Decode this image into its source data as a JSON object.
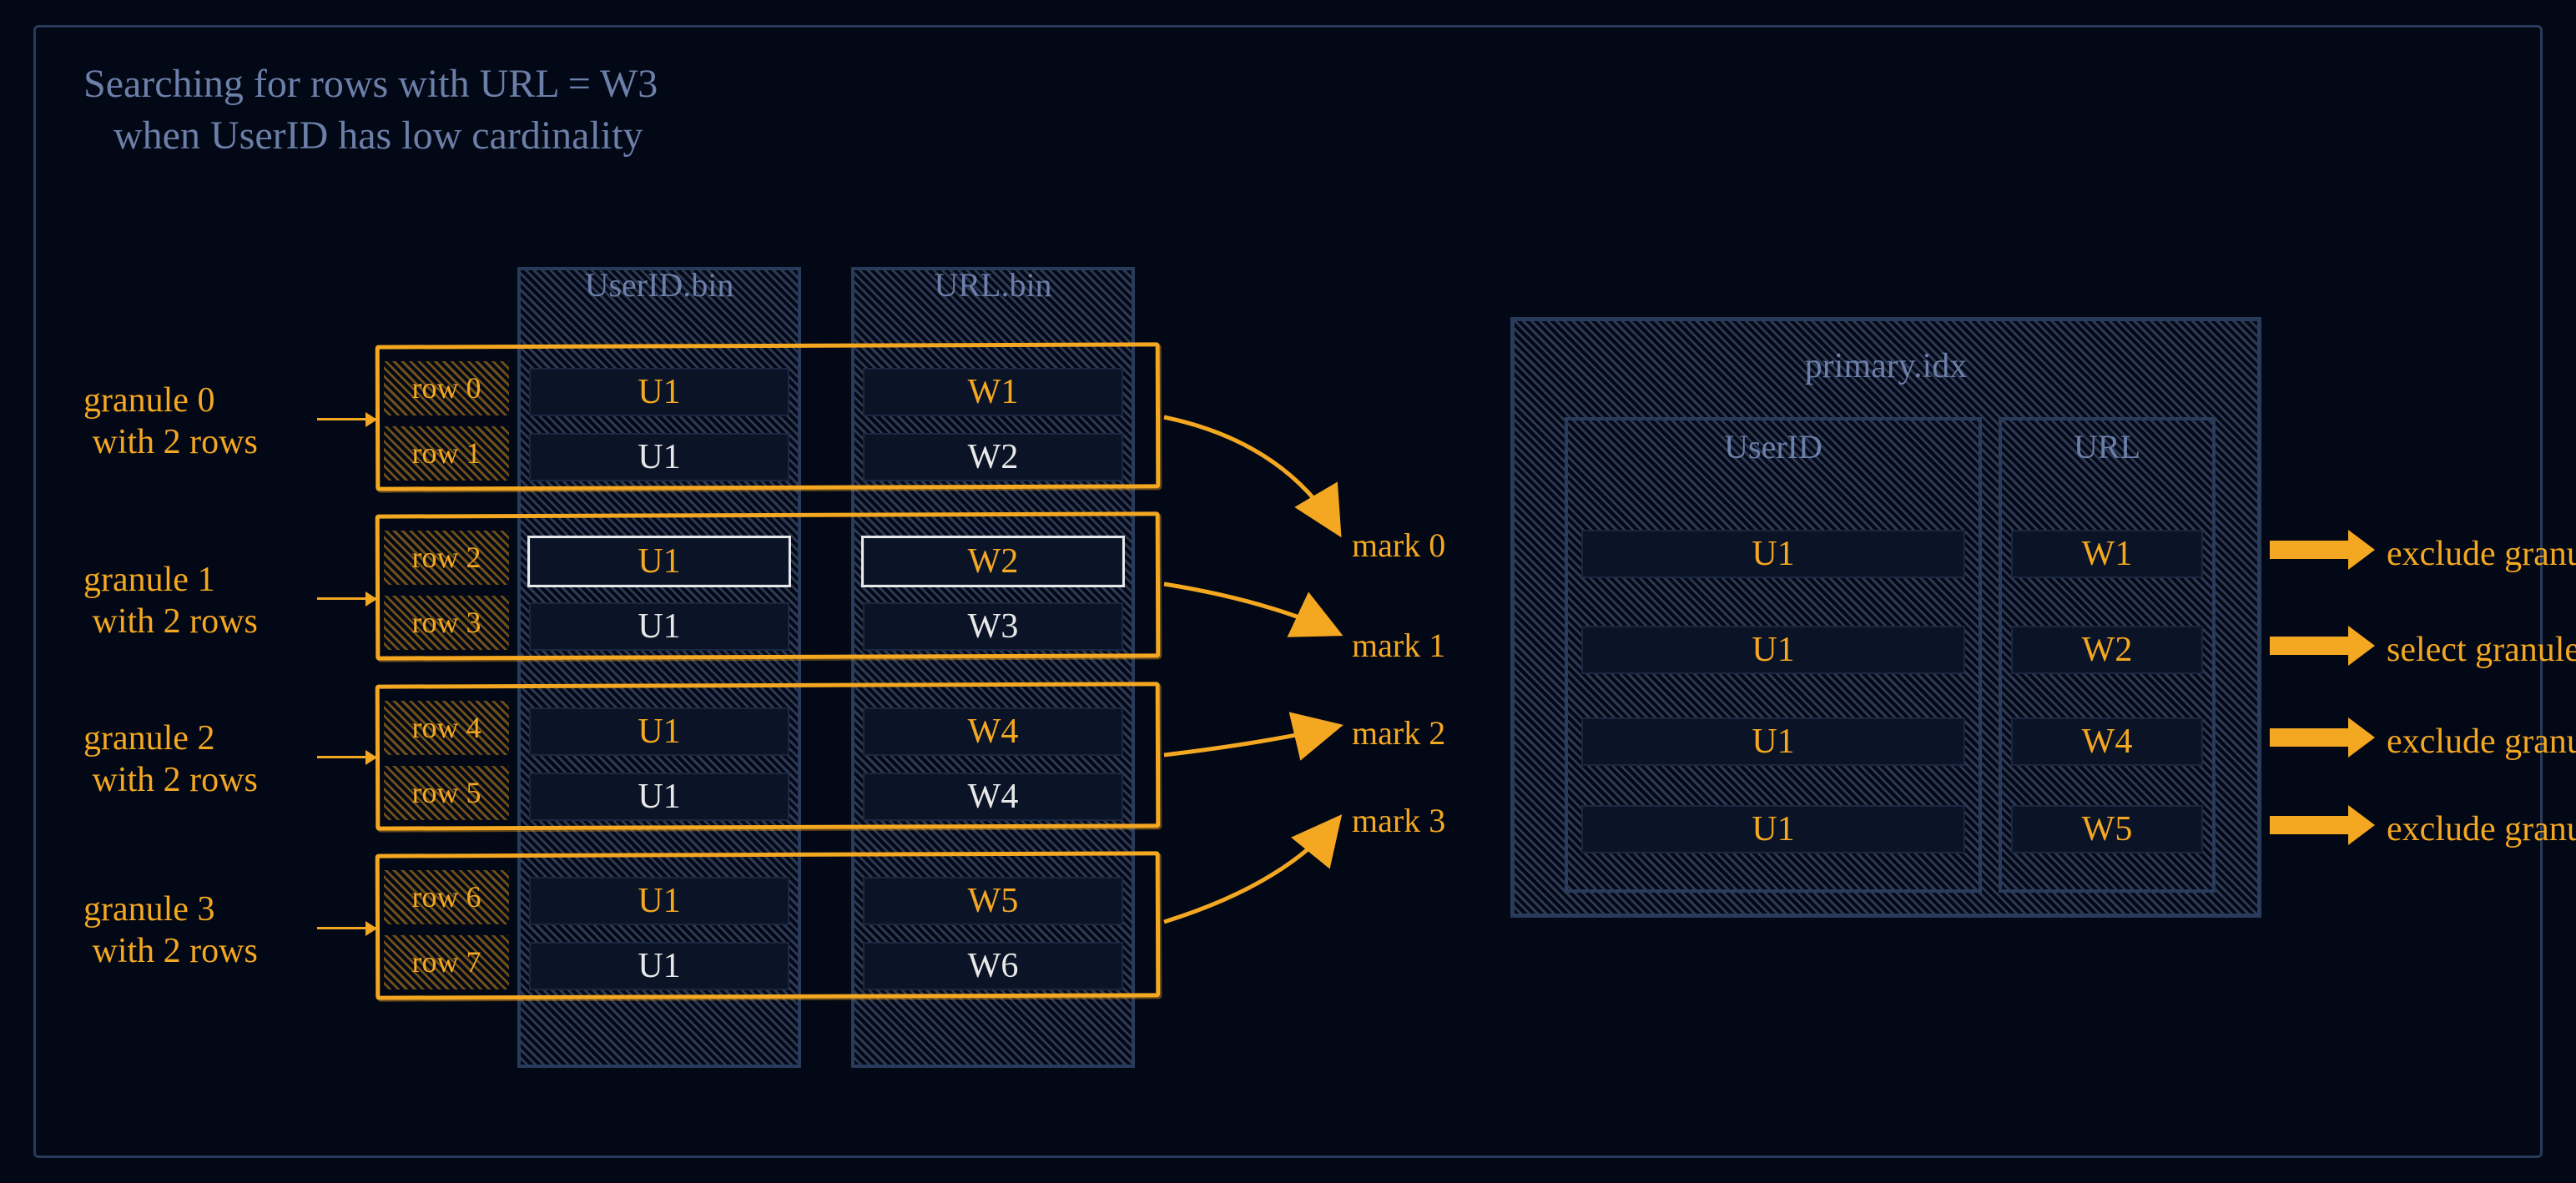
{
  "title": "Searching for rows with URL = W3\n   when UserID has low cardinality",
  "columns": {
    "userid": "UserID.bin",
    "url": "URL.bin"
  },
  "row_labels": [
    "row 0",
    "row 1",
    "row 2",
    "row 3",
    "row 4",
    "row 5",
    "row 6",
    "row 7"
  ],
  "granule_captions": [
    "granule 0\n with 2 rows",
    "granule 1\n with 2 rows",
    "granule 2\n with 2 rows",
    "granule 3\n with 2 rows"
  ],
  "mark_labels": [
    "mark 0",
    "mark 1",
    "mark 2",
    "mark 3"
  ],
  "primary_idx": {
    "title": "primary.idx",
    "headers": {
      "userid": "UserID",
      "url": "URL"
    }
  },
  "verdicts": [
    "exclude granule",
    "select granule",
    "exclude granule",
    "exclude granule"
  ],
  "chart_data": {
    "type": "table",
    "description": "Sparse primary index example: table sorted by (UserID, URL), 8 rows in 4 granules of 2 rows each, plus the corresponding primary.idx marks and whether each granule is selected when searching for URL = 'W3'.",
    "rows": [
      {
        "row": 0,
        "granule": 0,
        "UserID": "U1",
        "URL": "W1"
      },
      {
        "row": 1,
        "granule": 0,
        "UserID": "U1",
        "URL": "W2"
      },
      {
        "row": 2,
        "granule": 1,
        "UserID": "U1",
        "URL": "W2"
      },
      {
        "row": 3,
        "granule": 1,
        "UserID": "U1",
        "URL": "W3"
      },
      {
        "row": 4,
        "granule": 2,
        "UserID": "U1",
        "URL": "W4"
      },
      {
        "row": 5,
        "granule": 2,
        "UserID": "U1",
        "URL": "W4"
      },
      {
        "row": 6,
        "granule": 3,
        "UserID": "U1",
        "URL": "W5"
      },
      {
        "row": 7,
        "granule": 3,
        "UserID": "U1",
        "URL": "W6"
      }
    ],
    "marks": [
      {
        "mark": 0,
        "UserID": "U1",
        "URL": "W1",
        "action": "exclude granule"
      },
      {
        "mark": 1,
        "UserID": "U1",
        "URL": "W2",
        "action": "select granule"
      },
      {
        "mark": 2,
        "UserID": "U1",
        "URL": "W4",
        "action": "exclude granule"
      },
      {
        "mark": 3,
        "UserID": "U1",
        "URL": "W5",
        "action": "exclude granule"
      }
    ],
    "highlighted_row": 2
  }
}
